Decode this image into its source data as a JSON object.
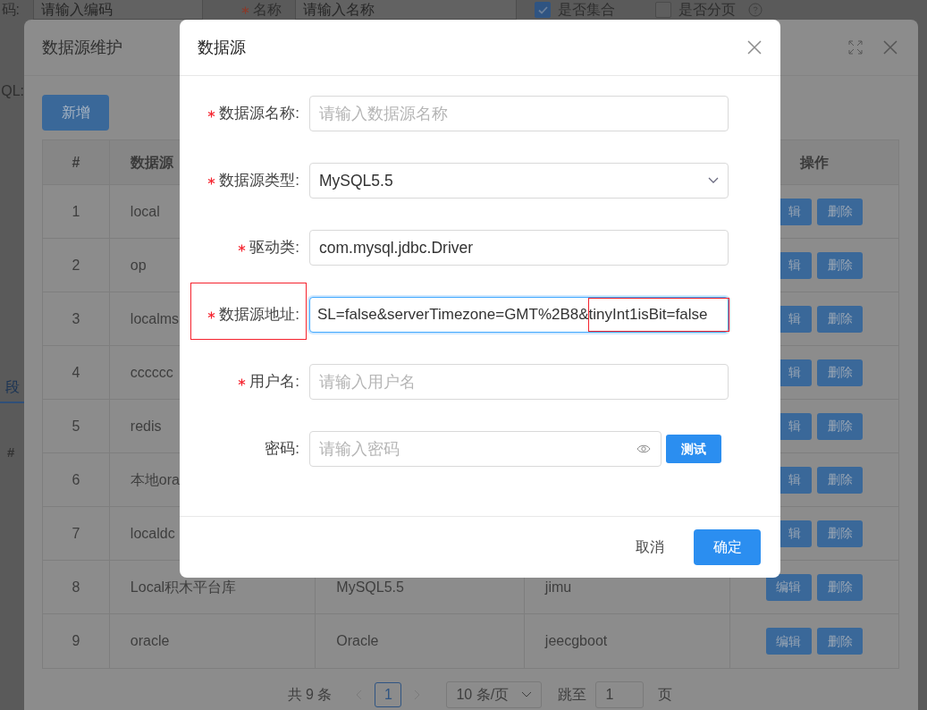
{
  "page": {
    "filters": [
      {
        "kind": "input",
        "label": "码:",
        "required": false,
        "placeholder": "请输入编码"
      },
      {
        "kind": "input",
        "label": "名称",
        "required": true,
        "placeholder": "请输入名称"
      },
      {
        "kind": "checkbox",
        "label": "是否集合",
        "checked": true
      },
      {
        "kind": "checkbox",
        "label": "是否分页",
        "checked": false,
        "help": true
      }
    ],
    "sql_label": "QL:",
    "tab": {
      "label": "段",
      "selected": true
    },
    "grid_header": "#"
  },
  "maintenance_dialog": {
    "title": "数据源维护",
    "add_button": "新增",
    "table": {
      "columns": [
        "#",
        "数据源",
        "",
        "",
        "操作"
      ],
      "rows": [
        {
          "index": "1",
          "name": "local",
          "edit": "辑",
          "delete": "删除"
        },
        {
          "index": "2",
          "name": "op",
          "edit": "辑",
          "delete": "删除"
        },
        {
          "index": "3",
          "name": "localms",
          "edit": "辑",
          "delete": "删除"
        },
        {
          "index": "4",
          "name": "cccccc",
          "edit": "辑",
          "delete": "删除"
        },
        {
          "index": "5",
          "name": "redis",
          "edit": "辑",
          "delete": "删除"
        },
        {
          "index": "6",
          "name": "本地ora",
          "edit": "辑",
          "delete": "删除"
        },
        {
          "index": "7",
          "name": "localdc",
          "edit": "辑",
          "delete": "删除"
        },
        {
          "index": "8",
          "name": "Local积木平台库",
          "column_3": "MySQL5.5",
          "column_4": "jimu",
          "edit": "编辑",
          "delete": "删除"
        },
        {
          "index": "9",
          "name": "oracle",
          "column_3": "Oracle",
          "column_4": "jeecgboot",
          "edit": "编辑",
          "delete": "删除"
        }
      ]
    },
    "pagination": {
      "total": "共 9 条",
      "pages": [
        {
          "label": "1",
          "selected": true
        }
      ],
      "page_size": "10 条/页",
      "jump_label": "跳至",
      "jump_value": "1",
      "page_unit": "页"
    }
  },
  "datasource_dialog": {
    "title": "数据源",
    "fields": [
      {
        "kind": "text",
        "label": "数据源名称:",
        "required": true,
        "placeholder": "请输入数据源名称",
        "focused": false
      },
      {
        "kind": "select",
        "label": "数据源类型:",
        "required": true,
        "value": "MySQL5.5",
        "focused": false
      },
      {
        "kind": "text",
        "label": "驱动类:",
        "required": true,
        "value": "com.mysql.jdbc.Driver",
        "focused": false
      },
      {
        "kind": "text",
        "label": "数据源地址:",
        "required": true,
        "value": "SL=false&serverTimezone=GMT%2B8&tinyInt1isBit=false",
        "focused": true,
        "label_highlighted": true,
        "value_tail_highlighted": true
      },
      {
        "kind": "text",
        "label": "用户名:",
        "required": true,
        "placeholder": "请输入用户名",
        "focused": false
      },
      {
        "kind": "password",
        "label": "密码:",
        "required": false,
        "placeholder": "请输入密码",
        "button": "测试",
        "focused": false
      }
    ],
    "cancel_button": "取消",
    "ok_button": "确定"
  }
}
